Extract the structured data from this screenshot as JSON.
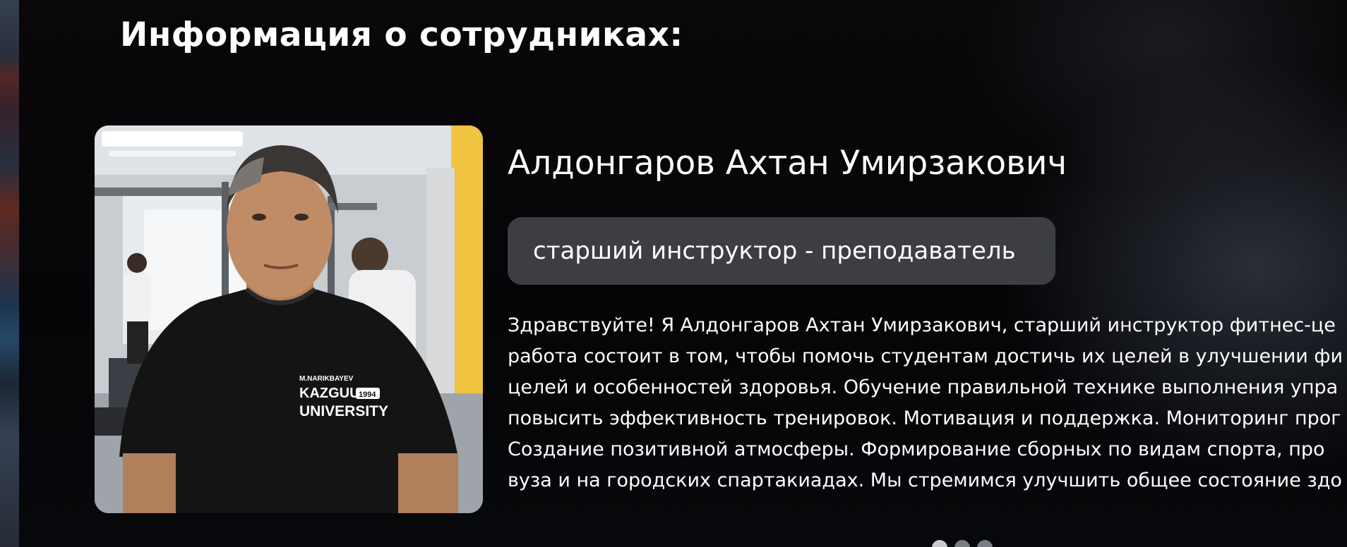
{
  "section": {
    "title": "Информация о сотрудниках:"
  },
  "employee": {
    "name": "Алдонгаров Ахтан Умирзакович",
    "role": "старший инструктор - преподаватель",
    "photo": {
      "shirt_text": [
        "M.NARIKBAYEV",
        "KAZGUU",
        "1994",
        "UNIVERSITY"
      ]
    },
    "bio_lines": [
      "Здравствуйте! Я Алдонгаров Ахтан Умирзакович, старший инструктор фитнес-це",
      "работа состоит в том, чтобы помочь студентам достичь их целей в улучшении фи",
      "целей и особенностей здоровья. Обучение правильной технике выполнения упра",
      "повысить эффективность тренировок. Мотивация и поддержка. Мониторинг прог",
      "Создание позитивной атмосферы. Формирование сборных по видам спорта, про",
      "вуза и на городских спартакиадах. Мы стремимся улучшить общее состояние здо"
    ]
  },
  "carousel": {
    "dot_count": 3,
    "active_index": 0
  },
  "colors": {
    "background": "#050507",
    "badge": "#3c3e44",
    "text": "#ffffff"
  }
}
